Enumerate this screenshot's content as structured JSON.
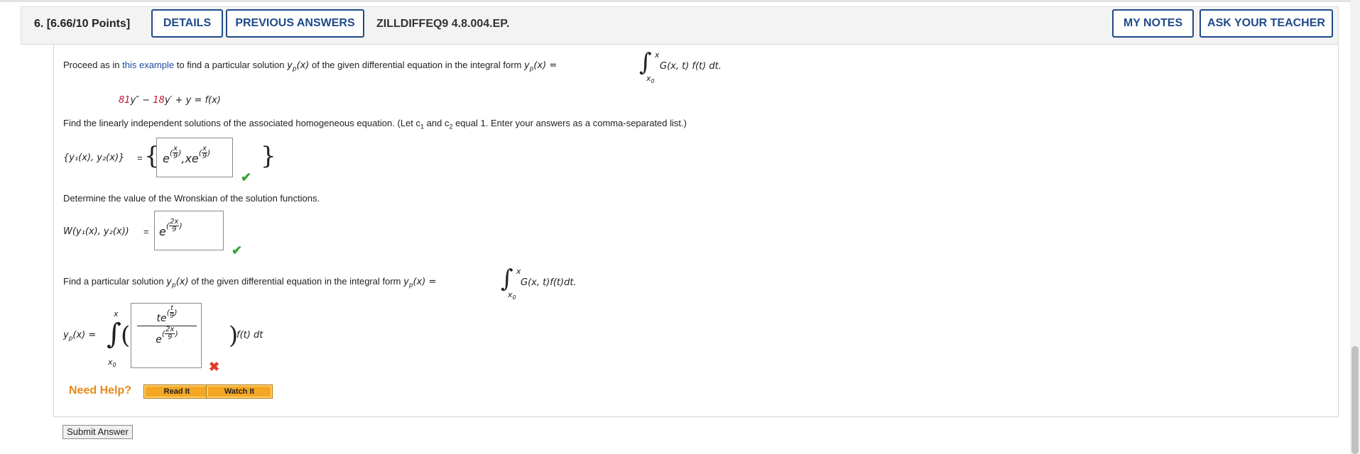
{
  "header": {
    "question_label": "6.  [6.66/10 Points]",
    "details_label": "DETAILS",
    "previous_answers_label": "PREVIOUS ANSWERS",
    "question_code": "ZILLDIFFEQ9 4.8.004.EP.",
    "my_notes_label": "MY NOTES",
    "ask_teacher_label": "ASK YOUR TEACHER"
  },
  "intro": {
    "prefix": "Proceed as in",
    "link_text": "this example",
    "suffix": "to find a particular solution",
    "yp": "y",
    "yp_sub": "p",
    "yp_arg": "(x)",
    "suffix2": "of the given differential equation in the integral form",
    "integrand": "G(x, t) f(t) dt."
  },
  "equation": {
    "coef1": "81",
    "part1": "y″ − ",
    "coef2": "18",
    "part2": "y′ + y = f(x)"
  },
  "part1": {
    "prompt": "Find the linearly independent solutions of the associated homogeneous equation. (Let c",
    "prompt_sub1": "1",
    "prompt_mid": " and c",
    "prompt_sub2": "2",
    "prompt_end": " equal 1. Enter your answers as a comma-separated list.)",
    "lhs": "{y₁(x), y₂(x)}",
    "equals": "=",
    "answer_e": "e",
    "answer_frac_num": "x",
    "answer_frac_den": "9",
    "answer_sep": ",xe",
    "status": "correct"
  },
  "part2": {
    "prompt": "Determine the value of the Wronskian of the solution functions.",
    "lhs": "W(y₁(x), y₂(x))",
    "equals": "=",
    "answer_e": "e",
    "answer_frac_num": "2x",
    "answer_frac_den": "9",
    "status": "correct"
  },
  "part3": {
    "prompt": "Find a particular solution",
    "prompt_mid": "of the given differential equation in the integral form",
    "integrand": "G(x, t)f(t)dt.",
    "lhs": "y",
    "lhs_sub": "p",
    "lhs_arg": "(x) =",
    "upper": "x",
    "lower": "x",
    "lower_sub": "0",
    "answer_num_te": "te",
    "answer_num_frac_num": "t",
    "answer_num_frac_den": "9",
    "answer_den_e": "e",
    "answer_den_frac_num": "2x",
    "answer_den_frac_den": "9",
    "tail": "f(t) dt",
    "status": "incorrect"
  },
  "help": {
    "label": "Need Help?",
    "read_it": "Read It",
    "watch_it": "Watch It"
  },
  "submit_label": "Submit Answer",
  "colors": {
    "accent": "#1f4a89",
    "link": "#1f4aa8",
    "highlight": "#c8102e",
    "correct": "#3aa23a",
    "incorrect": "#e03a2a",
    "help": "#e58a1a"
  }
}
